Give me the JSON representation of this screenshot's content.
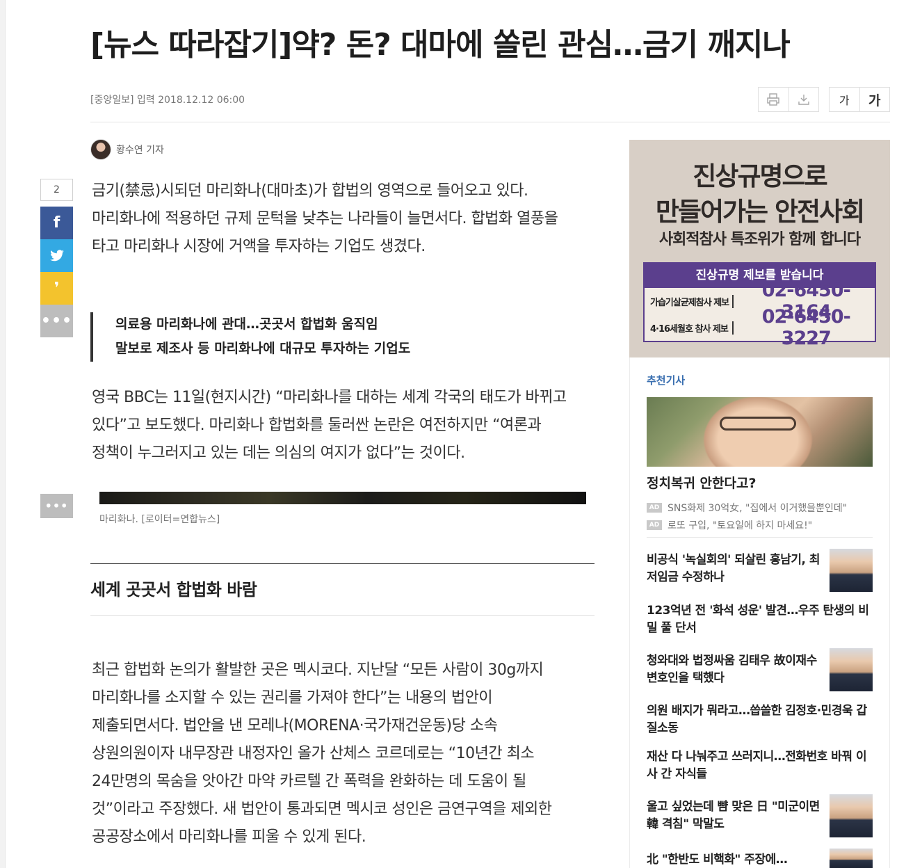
{
  "article": {
    "headline": "[뉴스 따라잡기]약? 돈? 대마에 쏠린 관심…금기 깨지나",
    "byline": "[중앙일보] 입력 2018.12.12 06:00",
    "reporter": "황수연 기자",
    "share_count": "2",
    "paragraph1": [
      " 금기(禁忌)시되던 마리화나(대마초)가 합법의 영역으로 들어오고 있다.",
      "마리화나에 적용하던 규제 문턱을 낮추는 나라들이 늘면서다. 합법화 열풍을",
      "타고 마리화나 시장에 거액을 투자하는 기업도 생겼다."
    ],
    "quote": [
      "의료용 마리화나에 관대…곳곳서 합법화 움직임",
      "말보로 제조사 등 마리화나에 대규모 투자하는 기업도"
    ],
    "paragraph2": [
      "영국 BBC는 11일(현지시간) “마리화나를 대하는 세계 각국의 태도가 바뀌고",
      "있다”고 보도했다. 마리화나 합법화를 둘러싼 논란은 여전하지만 “여론과",
      "정책이 누그러지고 있는 데는 의심의 여지가 없다”는 것이다."
    ],
    "photo_caption": "마리화나. [로이터=연합뉴스]",
    "subheading": "세계 곳곳서 합법화 바람",
    "paragraph3": [
      "최근 합법화 논의가 활발한 곳은 멕시코다. 지난달 “모든 사람이 30g까지",
      "마리화나를 소지할 수 있는 권리를 가져야 한다”는 내용의 법안이",
      "제출되면서다. 법안을 낸 모레나(MORENA·국가재건운동)당 소속",
      "상원의원이자 내무장관 내정자인 올가 산체스 코르데로는 “10년간 최소",
      "24만명의 목숨을 앗아간 마약 카르텔 간 폭력을 완화하는 데 도움이 될",
      "것”이라고 주장했다. 새 법안이 통과되면 멕시코 성인은 금연구역을 제외한",
      "공공장소에서 마리화나를 피울 수 있게 된다."
    ]
  },
  "toolbar": {
    "print_icon": "printer-icon",
    "download_icon": "download-icon",
    "font_small": "가",
    "font_large": "가"
  },
  "share": {
    "facebook": "f",
    "twitter_icon": "twitter-bird-icon",
    "kakaostory": "❜",
    "more": "•••"
  },
  "ad_banner": {
    "line1": "진상규명으로",
    "line2": "만들어가는 안전사회",
    "line3": "사회적참사 특조위가 함께 합니다",
    "box_title": "진상규명 제보를 받습니다",
    "rows": [
      {
        "label": "가습기살균제참사 제보",
        "phone": "02-6450-3164"
      },
      {
        "label": "4·16세월호 참사 제보",
        "phone": "02-6450-3227"
      }
    ]
  },
  "sidebar": {
    "label": "추천기사",
    "featured_title": "정치복귀 안한다고?",
    "ads": [
      "SNS화제 30억女, \"집에서 이거했을뿐인데\"",
      "로또 구입, \"토요일에 하지 마세요!\""
    ],
    "ad_tag": "AD",
    "news": [
      {
        "title": "비공식 '녹실회의' 되살린 홍남기, 최저임금 수정하나"
      },
      {
        "title": "123억년 전 '화석 성운' 발견…우주 탄생의 비밀 풀 단서"
      },
      {
        "title": "청와대와 법정싸움 김태우 故이재수 변호인을 택했다"
      },
      {
        "title": "의원 배지가 뭐라고…씁쓸한 김정호·민경욱 갑질소동"
      },
      {
        "title": "재산 다 나눠주고 쓰러지니…전화번호 바꿔 이사 간 자식들"
      },
      {
        "title": "울고 싶었는데 뺨 맞은 日 \"미군이면 韓 격침\" 막말도"
      },
      {
        "title": "北 \"한반도 비핵화\" 주장에…"
      }
    ]
  }
}
